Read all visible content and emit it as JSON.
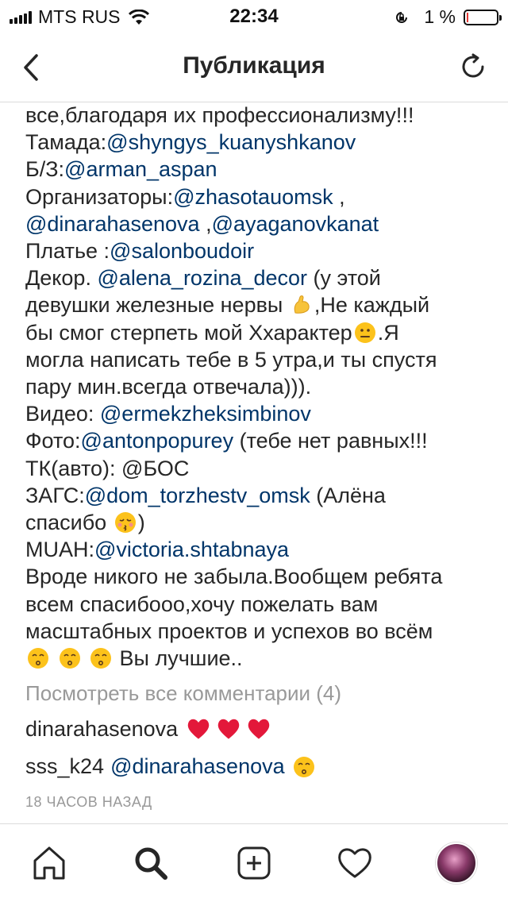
{
  "status_bar": {
    "carrier": "MTS RUS",
    "time": "22:34",
    "battery_percent": "1 %",
    "battery_level": 0.01
  },
  "nav": {
    "title": "Публикация",
    "back_icon": "chevron-left-icon",
    "refresh_icon": "refresh-icon"
  },
  "caption": {
    "l1": "все,благодаря их профессионализму!!!",
    "l2_text": "Тамада:",
    "l2_mention": "@shyngys_kuanyshkanov",
    "l3_text": "Б/З:",
    "l3_mention": "@arman_aspan",
    "l4_text": "Организаторы:",
    "l4_mention": "@zhasotauomsk",
    "l4_after": " ,",
    "l5_mention_a": "@dinarahasenova",
    "l5_sep": " ,",
    "l5_mention_b": "@ayaganovkanat",
    "l6_text": "Платье :",
    "l6_mention": "@salonboudoir",
    "l7_text": "Декор. ",
    "l7_mention": "@alena_rozina_decor",
    "l7_after": " (у этой",
    "l8_text": "девушки железные нервы ",
    "l8_after": ",Не каждый",
    "l9_text": "бы смог стерпеть мой Ххарактер",
    "l9_after": ".Я",
    "l10": "могла написать тебе в 5 утра,и ты спустя",
    "l11": "пару мин.всегда отвечала))).",
    "l12_text": "Видео: ",
    "l12_mention": "@ermekzheksimbinov",
    "l13_text": "Фото:",
    "l13_mention": "@antonpopurey",
    "l13_after": " (тебе нет равных!!!",
    "l14": "ТК(авто): @БОС",
    "l15_text": "ЗАГС:",
    "l15_mention": "@dom_torzhestv_omsk",
    "l15_after": " (Алёна",
    "l16_text": "спасибо ",
    "l16_after": ")",
    "l17_text": "MUAH:",
    "l17_mention": "@victoria.shtabnaya",
    "l18": "Вроде никого не забыла.Вообщем ребята",
    "l19": "всем спасибооо,хочу пожелать вам",
    "l20": "масштабных проектов и успехов во всём",
    "l21_after": "Вы лучшие.."
  },
  "view_all_comments": "Посмотреть все комментарии (4)",
  "comments": [
    {
      "user": "dinarahasenova",
      "text": ""
    },
    {
      "user": "sss_k24",
      "mention": "@dinarahasenova"
    }
  ],
  "timestamp": "18 ЧАСОВ НАЗАД",
  "tabs": [
    "home-icon",
    "search-icon",
    "new-post-icon",
    "heart-icon",
    "profile-avatar"
  ],
  "colors": {
    "mention": "#003569",
    "muted": "#999999",
    "heart": "#e3183a"
  }
}
